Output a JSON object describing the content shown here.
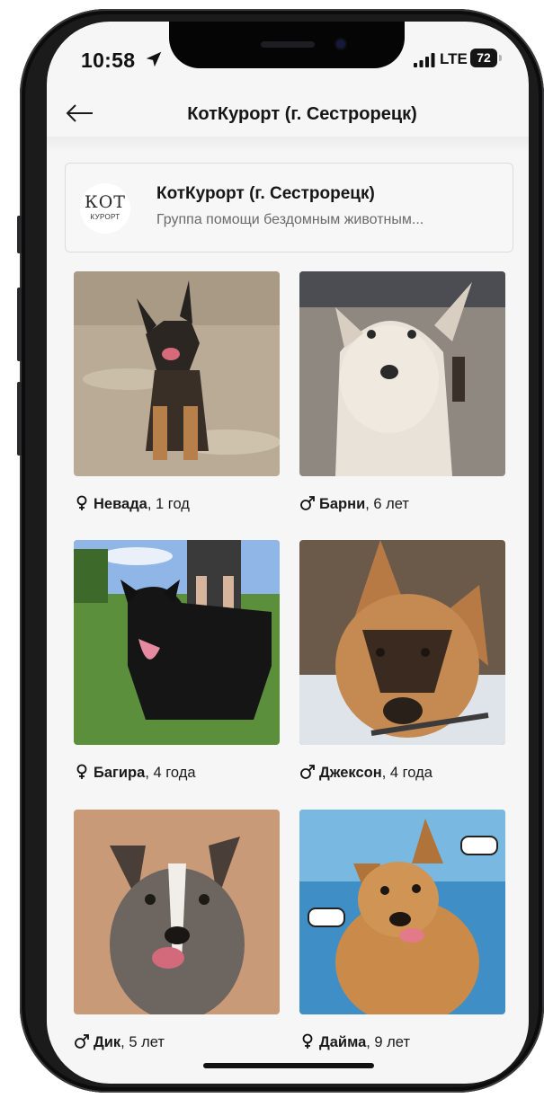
{
  "status_bar": {
    "time": "10:58",
    "network": "LTE",
    "battery": "72"
  },
  "header": {
    "title": "КотКурорт (г. Сестрорецк)",
    "back_icon": "arrow-left-icon"
  },
  "organization": {
    "logo_text": "КОТ",
    "logo_subtext": "КУРОРТ",
    "name": "КотКурорт (г. Сестрорецк)",
    "description": "Группа помощи бездомным животным..."
  },
  "animals": [
    {
      "name": "Невада",
      "age": "1 год",
      "sex": "female",
      "sex_icon": "female-symbol-icon",
      "photo": "dog-photo-german-shepherd-sitting"
    },
    {
      "name": "Барни",
      "age": "6 лет",
      "sex": "male",
      "sex_icon": "male-symbol-icon",
      "photo": "dog-photo-light-husky-mix"
    },
    {
      "name": "Багира",
      "age": "4 года",
      "sex": "female",
      "sex_icon": "female-symbol-icon",
      "photo": "dog-photo-black-dog-on-grass"
    },
    {
      "name": "Джексон",
      "age": "4 года",
      "sex": "male",
      "sex_icon": "male-symbol-icon",
      "photo": "dog-photo-shepherd-portrait"
    },
    {
      "name": "Дик",
      "age": "5 лет",
      "sex": "male",
      "sex_icon": "male-symbol-icon",
      "photo": "dog-photo-grey-dog-tongue"
    },
    {
      "name": "Дайма",
      "age": "9 лет",
      "sex": "female",
      "sex_icon": "female-symbol-icon",
      "photo": "dog-photo-ginger-dog-blue-backdrop"
    }
  ],
  "colors": {
    "background": "#f6f6f6",
    "text": "#161616",
    "muted_text": "#6a6a6a",
    "card_border": "#dcdcdc"
  }
}
